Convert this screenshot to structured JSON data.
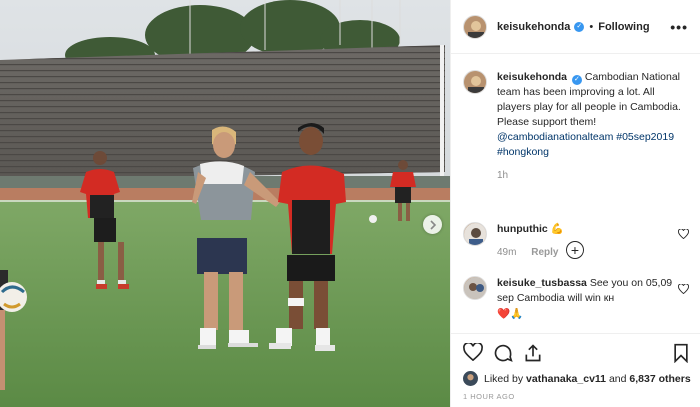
{
  "post": {
    "author": "keisukehonda",
    "follow_label": "Following",
    "more_label": "•••",
    "caption": {
      "username": "keisukehonda",
      "text": "Cambodian National team has been improving a lot. All players play for all people in Cambodia. Please support them!",
      "mention": "@cambodianationalteam",
      "tag1": "#05sep2019",
      "tag2": "#hongkong",
      "time": "1h"
    },
    "comments": [
      {
        "username": "hunputhic",
        "text": "💪",
        "time": "49m",
        "reply_label": "Reply"
      },
      {
        "username": "keisuke_tusbassa",
        "text": "See you on 05,09 sep Cambodia will win ​кн",
        "emoji": "❤️🙏"
      }
    ],
    "likes": {
      "prefix": "Liked by",
      "user": "vathanaka_cv11",
      "middle": "and",
      "count": "6,837 others"
    },
    "timestamp": "1 HOUR AGO"
  },
  "colors": {
    "verified": "#3897f0",
    "link": "#003569",
    "muted": "#8e8e8e"
  },
  "icons": [
    "verified-icon",
    "add-comment-icon",
    "heart-icon",
    "comment-icon",
    "share-icon",
    "bookmark-icon",
    "next-arrow-icon"
  ]
}
